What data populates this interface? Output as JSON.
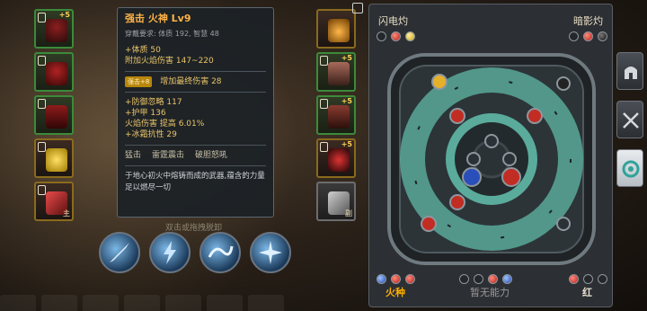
{
  "tooltip": {
    "title": "强击 火神 Lv9",
    "requirement": "穿戴要求:  体质 192, 智慧 48",
    "base_stats": [
      "+体质 50",
      "附加火焰伤害 147~220"
    ],
    "enhance_tag": "强击+8",
    "enhance_stat": "增加最终伤害 28",
    "extra_stats": [
      "+防御忽略 117",
      "+护甲 136",
      "火焰伤害 提高 6.01%",
      "+冰霜抗性 29"
    ],
    "skills": [
      "猛击",
      "雷霆震击",
      "破胆怒吼"
    ],
    "description": "于地心初火中熔铸而成的武器,蕴含的力量足以燃尽一切"
  },
  "equipment": {
    "left": [
      {
        "name": "helmet",
        "plus": "+5",
        "color": "green"
      },
      {
        "name": "shoulder",
        "plus": "",
        "color": "green"
      },
      {
        "name": "armor",
        "plus": "",
        "color": "green"
      },
      {
        "name": "ring",
        "plus": "",
        "color": "gold"
      },
      {
        "name": "weapon",
        "plus": "",
        "color": "gold",
        "badge": "主"
      }
    ],
    "right": [
      {
        "name": "necklace",
        "plus": "",
        "color": "gold"
      },
      {
        "name": "gloves",
        "plus": "+5",
        "color": "green"
      },
      {
        "name": "boots",
        "plus": "+5",
        "color": "green"
      },
      {
        "name": "orb",
        "plus": "+5",
        "color": "gold"
      },
      {
        "name": "offhand",
        "plus": "",
        "color": "plain",
        "badge": "副"
      }
    ]
  },
  "hint": "双击或拖拽脱卸",
  "skills": [
    "skill-1",
    "skill-2",
    "skill-3",
    "skill-4"
  ],
  "panel": {
    "top_left_label": "闪电灼",
    "top_right_label": "暗影灼",
    "bottom_left_label": "火种",
    "bottom_center_label": "暂无能力",
    "bottom_right_label": "红",
    "bottom_left_color": "#ffb000",
    "bottom_center_color": "#9a9a9a",
    "bottom_right_color": "#e8e0d0"
  },
  "side_tabs": [
    "helmet-tab",
    "sword-tab",
    "gem-tab"
  ]
}
